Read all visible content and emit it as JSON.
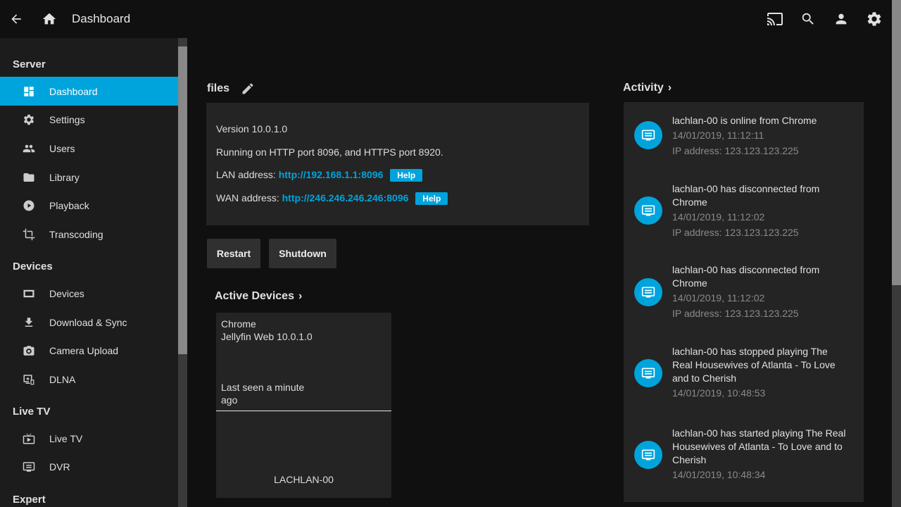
{
  "header": {
    "back_icon": "arrow-left-icon",
    "home_icon": "home-icon",
    "title": "Dashboard",
    "actions": [
      {
        "name": "cast",
        "icon": "cast-icon"
      },
      {
        "name": "search",
        "icon": "search-icon"
      },
      {
        "name": "user",
        "icon": "person-icon"
      },
      {
        "name": "settings",
        "icon": "gear-icon"
      }
    ]
  },
  "sidebar": {
    "sections": [
      {
        "title": "Server",
        "items": [
          {
            "label": "Dashboard",
            "icon": "dashboard-icon",
            "active": true
          },
          {
            "label": "Settings",
            "icon": "gear-icon"
          },
          {
            "label": "Users",
            "icon": "people-icon"
          },
          {
            "label": "Library",
            "icon": "folder-icon"
          },
          {
            "label": "Playback",
            "icon": "play-circle-icon"
          },
          {
            "label": "Transcoding",
            "icon": "crop-icon"
          }
        ]
      },
      {
        "title": "Devices",
        "items": [
          {
            "label": "Devices",
            "icon": "device-icon"
          },
          {
            "label": "Download & Sync",
            "icon": "download-icon"
          },
          {
            "label": "Camera Upload",
            "icon": "camera-icon"
          },
          {
            "label": "DLNA",
            "icon": "dlna-icon"
          }
        ]
      },
      {
        "title": "Live TV",
        "items": [
          {
            "label": "Live TV",
            "icon": "live-tv-icon"
          },
          {
            "label": "DVR",
            "icon": "dvr-icon"
          }
        ]
      },
      {
        "title": "Expert",
        "items": []
      }
    ]
  },
  "server": {
    "name": "files",
    "edit_icon": "pencil-icon",
    "version": "Version 10.0.1.0",
    "ports": "Running on HTTP port 8096, and HTTPS port 8920.",
    "lan_label": "LAN address:",
    "lan_url": "http://192.168.1.1:8096",
    "wan_label": "WAN address:",
    "wan_url": "http://246.246.246.246:8096",
    "help_label": "Help",
    "restart_label": "Restart",
    "shutdown_label": "Shutdown"
  },
  "active_devices": {
    "title": "Active Devices",
    "chevron": "›",
    "devices": [
      {
        "client": "Chrome",
        "app": "Jellyfin Web 10.0.1.0",
        "last_seen": "Last seen a minute ago",
        "name": "LACHLAN-00"
      }
    ]
  },
  "activity": {
    "title": "Activity",
    "chevron": "›",
    "items": [
      {
        "text": "lachlan-00 is online from Chrome",
        "time": "14/01/2019, 11:12:11",
        "detail": "IP address: 123.123.123.225"
      },
      {
        "text": "lachlan-00 has disconnected from Chrome",
        "time": "14/01/2019, 11:12:02",
        "detail": "IP address: 123.123.123.225"
      },
      {
        "text": "lachlan-00 has disconnected from Chrome",
        "time": "14/01/2019, 11:12:02",
        "detail": "IP address: 123.123.123.225"
      },
      {
        "text": "lachlan-00 has stopped playing The Real Housewives of Atlanta - To Love and to Cherish",
        "time": "14/01/2019, 10:48:53",
        "detail": ""
      },
      {
        "text": "lachlan-00 has started playing The Real Housewives of Atlanta - To Love and to Cherish",
        "time": "14/01/2019, 10:48:34",
        "detail": ""
      }
    ]
  },
  "colors": {
    "accent": "#00a4dc",
    "background": "#101010",
    "sidebar": "#1c1c1c",
    "card": "#242424"
  }
}
